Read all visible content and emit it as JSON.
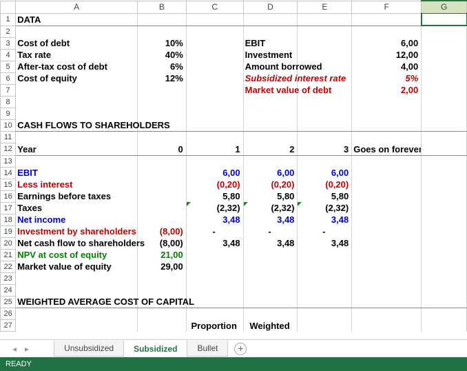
{
  "columns": [
    "A",
    "B",
    "C",
    "D",
    "E",
    "F",
    "G"
  ],
  "rows": [
    "1",
    "2",
    "3",
    "4",
    "5",
    "6",
    "7",
    "8",
    "9",
    "10",
    "11",
    "12",
    "13",
    "14",
    "15",
    "16",
    "17",
    "18",
    "19",
    "20",
    "21",
    "22",
    "23",
    "24",
    "25",
    "26",
    "27"
  ],
  "s1_title": "DATA",
  "r3": {
    "a": "Cost of debt",
    "b": "10%",
    "d": "EBIT",
    "f": "6,00"
  },
  "r4": {
    "a": "Tax rate",
    "b": "40%",
    "d": "Investment",
    "f": "12,00"
  },
  "r5": {
    "a": "After-tax cost of debt",
    "b": "6%",
    "d": "Amount borrowed",
    "f": "4,00"
  },
  "r6": {
    "a": "Cost of equity",
    "b": "12%",
    "d": "Subsidized interest rate",
    "f": "5%"
  },
  "r7": {
    "d": "Market value of debt",
    "f": "2,00"
  },
  "s2_title": "CASH FLOWS TO SHAREHOLDERS",
  "r12": {
    "a": "Year",
    "b": "0",
    "c": "1",
    "d": "2",
    "e": "3",
    "f": "Goes on forever"
  },
  "r14": {
    "a": "EBIT",
    "c": "6,00",
    "d": "6,00",
    "e": "6,00"
  },
  "r15": {
    "a": "Less interest",
    "c": "(0,20)",
    "d": "(0,20)",
    "e": "(0,20)"
  },
  "r16": {
    "a": "Earnings before taxes",
    "c": "5,80",
    "d": "5,80",
    "e": "5,80"
  },
  "r17": {
    "a": "Taxes",
    "c": "(2,32)",
    "d": "(2,32)",
    "e": "(2,32)"
  },
  "r18": {
    "a": "Net income",
    "c": "3,48",
    "d": "3,48",
    "e": "3,48"
  },
  "r19": {
    "a": "Investment by shareholders",
    "b": "(8,00)",
    "c": "-",
    "d": "-",
    "e": "-"
  },
  "r20": {
    "a": "Net cash flow to shareholders",
    "b": "(8,00)",
    "c": "3,48",
    "d": "3,48",
    "e": "3,48"
  },
  "r21": {
    "a": "NPV at cost of equity",
    "b": "21,00"
  },
  "r22": {
    "a": "Market value of equity",
    "b": "29,00"
  },
  "s3_title": "WEIGHTED AVERAGE COST OF CAPITAL",
  "r27": {
    "c": "Proportion",
    "d": "Weighted"
  },
  "tabs": {
    "t1": "Unsubsidized",
    "t2": "Subsidized",
    "t3": "Bullet"
  },
  "status": "READY",
  "chart_data": {
    "type": "table",
    "title": "Subsidized debt valuation worksheet",
    "inputs": {
      "cost_of_debt": 0.1,
      "tax_rate": 0.4,
      "after_tax_cost_of_debt": 0.06,
      "cost_of_equity": 0.12,
      "ebit": 6.0,
      "investment": 12.0,
      "amount_borrowed": 4.0,
      "subsidized_interest_rate": 0.05,
      "market_value_of_debt": 2.0
    },
    "cash_flows_to_shareholders": {
      "years": [
        0,
        1,
        2,
        3
      ],
      "note": "Goes on forever",
      "ebit": [
        null,
        6.0,
        6.0,
        6.0
      ],
      "less_interest": [
        null,
        -0.2,
        -0.2,
        -0.2
      ],
      "earnings_before_taxes": [
        null,
        5.8,
        5.8,
        5.8
      ],
      "taxes": [
        null,
        -2.32,
        -2.32,
        -2.32
      ],
      "net_income": [
        null,
        3.48,
        3.48,
        3.48
      ],
      "investment_by_shareholders": [
        -8.0,
        0,
        0,
        0
      ],
      "net_cash_flow_to_shareholders": [
        -8.0,
        3.48,
        3.48,
        3.48
      ],
      "npv_at_cost_of_equity": 21.0,
      "market_value_of_equity": 29.0
    },
    "wacc_headers": [
      "Proportion",
      "Weighted"
    ]
  }
}
